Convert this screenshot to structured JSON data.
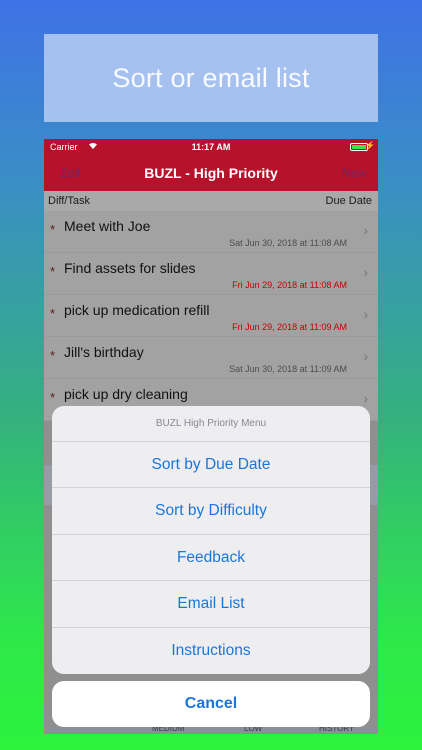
{
  "banner": {
    "text": "Sort or email list"
  },
  "status_bar": {
    "carrier": "Carrier",
    "time": "11:17 AM"
  },
  "nav": {
    "left": "Edit",
    "title": "BUZL - High Priority",
    "right": "New"
  },
  "columns": {
    "left": "Diff/Task",
    "right": "Due Date"
  },
  "tasks": [
    {
      "star": "*",
      "title": "Meet with Joe",
      "due": "Sat Jun 30, 2018 at 11:08 AM",
      "overdue": false
    },
    {
      "star": "*",
      "title": "Find assets for slides",
      "due": "Fri Jun 29, 2018 at 11:08 AM",
      "overdue": true
    },
    {
      "star": "*",
      "title": "pick up medication refill",
      "due": "Fri Jun 29, 2018 at 11:09 AM",
      "overdue": true
    },
    {
      "star": "*",
      "title": "Jill's birthday",
      "due": "Sat Jun 30, 2018 at 11:09 AM",
      "overdue": false
    },
    {
      "star": "*",
      "title": "pick up dry cleaning",
      "due": "",
      "overdue": false
    }
  ],
  "tabs": {
    "medium": "MEDIUM",
    "low": "LOW",
    "history": "HISTORY"
  },
  "action_sheet": {
    "title": "BUZL High Priority Menu",
    "options": [
      "Sort by Due Date",
      "Sort by Difficulty",
      "Feedback",
      "Email List",
      "Instructions"
    ],
    "cancel": "Cancel"
  },
  "colors": {
    "nav_red": "#b7122b",
    "action_blue": "#1a76dc",
    "overdue_red": "#c80000"
  },
  "icons": {
    "wifi": "wifi-icon",
    "battery": "battery-icon",
    "chevron": "chevron-right-icon"
  }
}
